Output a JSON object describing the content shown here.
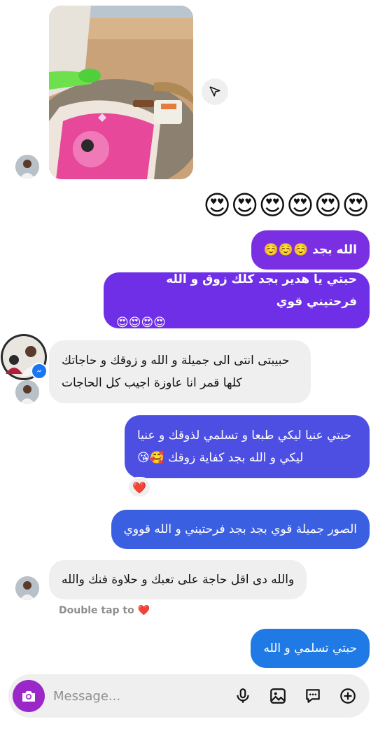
{
  "thread": {
    "emoji_reaction": "😍😍😍😍😍😍",
    "messages": [
      {
        "from": "me",
        "text": "الله بجد ☺️☺️☺️"
      },
      {
        "from": "me",
        "line1": "حبتي يا هدير بجد كلك زوق و الله فرحتيني قوي",
        "line2": "😍😍😍😍"
      },
      {
        "from": "them",
        "line1": "حبيبتى انتى الى جميلة و الله و زوقك و حاجاتك",
        "line2": "كلها قمر انا عاوزة اجيب كل الحاجات"
      },
      {
        "from": "me",
        "line1": "حبتي عنيا ليكي طبعا و تسلمي لذوقك و عنيا",
        "line2": "ليكي و الله بجد كفاية زوقك 🥰😘",
        "reaction": "❤️"
      },
      {
        "from": "me",
        "text": "الصور جميلة قوي بجد بجد فرحتيني و الله قووي"
      },
      {
        "from": "them",
        "text": "والله دى اقل حاجة على تعبك و حلاوة فنك والله"
      },
      {
        "from": "me",
        "text": "حبتي تسلمي و الله"
      }
    ],
    "double_tap_hint": "Double tap to",
    "double_tap_heart": "❤️"
  },
  "composer": {
    "placeholder": "Message...",
    "icons": [
      "camera-icon",
      "microphone-icon",
      "gallery-icon",
      "sticker-icon",
      "plus-icon"
    ]
  },
  "colors": {
    "purple": "#7a2fe3",
    "indigo": "#4d4fe3",
    "blue": "#1f7ae6",
    "incoming": "#efefef",
    "camera": "#9b27c9"
  }
}
